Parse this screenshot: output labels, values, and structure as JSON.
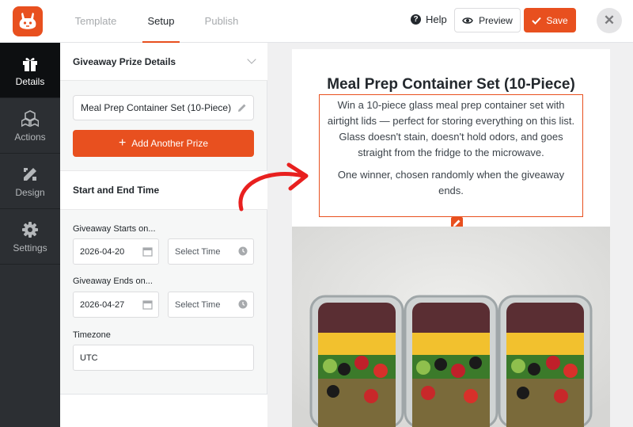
{
  "header": {
    "tabs": [
      {
        "label": "Template"
      },
      {
        "label": "Setup"
      },
      {
        "label": "Publish"
      }
    ],
    "help_label": "Help",
    "preview_label": "Preview",
    "save_label": "Save",
    "close_glyph": "✕"
  },
  "sidebar": {
    "items": [
      {
        "label": "Details",
        "icon": "gift-icon"
      },
      {
        "label": "Actions",
        "icon": "cubes-icon"
      },
      {
        "label": "Design",
        "icon": "design-tools-icon"
      },
      {
        "label": "Settings",
        "icon": "gear-icon"
      }
    ]
  },
  "panel": {
    "prize_section_title": "Giveaway Prize Details",
    "prize_name": "Meal Prep Container Set (10-Piece)",
    "add_prize_label": "Add Another Prize",
    "time_section_title": "Start and End Time",
    "start_label": "Giveaway Starts on...",
    "start_date": "2026-04-20",
    "start_time_placeholder": "Select Time",
    "end_label": "Giveaway Ends on...",
    "end_date": "2026-04-27",
    "end_time_placeholder": "Select Time",
    "timezone_label": "Timezone",
    "timezone_value": "UTC"
  },
  "preview": {
    "title": "Meal Prep Container Set (10-Piece)",
    "paragraphs": [
      "Win a 10-piece glass meal prep container set with airtight lids — perfect for storing everything on this list. Glass doesn't stain, doesn't hold odors, and goes straight from the fridge to the microwave.",
      "One winner, chosen randomly when the giveaway ends."
    ]
  },
  "colors": {
    "accent": "#e8501f",
    "nav_bg": "#2c2f33",
    "nav_active": "#0d0f11"
  }
}
